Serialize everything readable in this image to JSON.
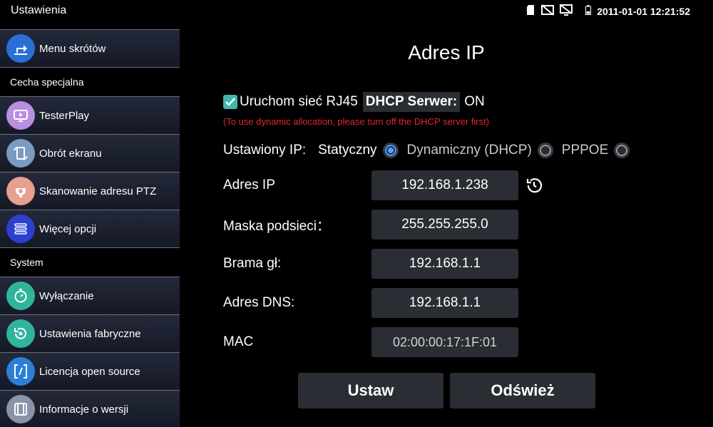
{
  "statusbar": {
    "title": "Ustawienia",
    "datetime": "2011-01-01 12:21:52",
    "icons": [
      "sd-card-icon",
      "no-camera-icon",
      "no-display-icon",
      "battery-icon"
    ]
  },
  "sidebar": {
    "items": [
      {
        "label": "Menu skrótów",
        "icon": "shortcut-icon",
        "color": "#2a6fd6"
      },
      {
        "label": "Cecha specjalna",
        "type": "header"
      },
      {
        "label": "TesterPlay",
        "icon": "testerplay-icon",
        "color": "#b98fe0"
      },
      {
        "label": "Obrót ekranu",
        "icon": "rotate-screen-icon",
        "color": "#7a9bc2"
      },
      {
        "label": "Skanowanie adresu PTZ",
        "icon": "ptz-scan-icon",
        "color": "#e6a08e"
      },
      {
        "label": "Więcej opcji",
        "icon": "more-options-icon",
        "color": "#2c3fd0"
      },
      {
        "label": "System",
        "type": "header"
      },
      {
        "label": "Wyłączanie",
        "icon": "timer-icon",
        "color": "#2fb59c"
      },
      {
        "label": "Ustawienia fabryczne",
        "icon": "factory-reset-icon",
        "color": "#2fb59c"
      },
      {
        "label": "Licencja open source",
        "icon": "code-icon",
        "color": "#2c7fd6"
      },
      {
        "label": "Informacje o wersji",
        "icon": "version-info-icon",
        "color": "#8a93a8"
      }
    ]
  },
  "main": {
    "title": "Adres IP",
    "rj45_label": "Uruchom sieć RJ45",
    "rj45_checked": true,
    "dhcp_label": "DHCP Serwer:",
    "dhcp_value": "ON",
    "warning": "(To use dynamic allocation, please turn off the DHCP server first)",
    "ip_mode_label": "Ustawiony IP:",
    "ip_modes": [
      {
        "label": "Statyczny",
        "selected": true
      },
      {
        "label": "Dynamiczny (DHCP)",
        "selected": false
      },
      {
        "label": "PPPOE",
        "selected": false
      }
    ],
    "fields": [
      {
        "label": "Adres IP",
        "value": "192.168.1.238"
      },
      {
        "label": "Maska podsieci：",
        "value": "255.255.255.0"
      },
      {
        "label": "Brama gł:",
        "value": "192.168.1.1"
      },
      {
        "label": "Adres DNS:",
        "value": "192.168.1.1"
      },
      {
        "label": "MAC",
        "value": "02:00:00:17:1F:01"
      }
    ],
    "set_button": "Ustaw",
    "refresh_button": "Odśwież"
  },
  "colors": {
    "accent_blue": "#4aa3ff",
    "checkbox_teal": "#3fb8b0",
    "warning_red": "#e0272e",
    "field_bg": "#2a2d33"
  }
}
